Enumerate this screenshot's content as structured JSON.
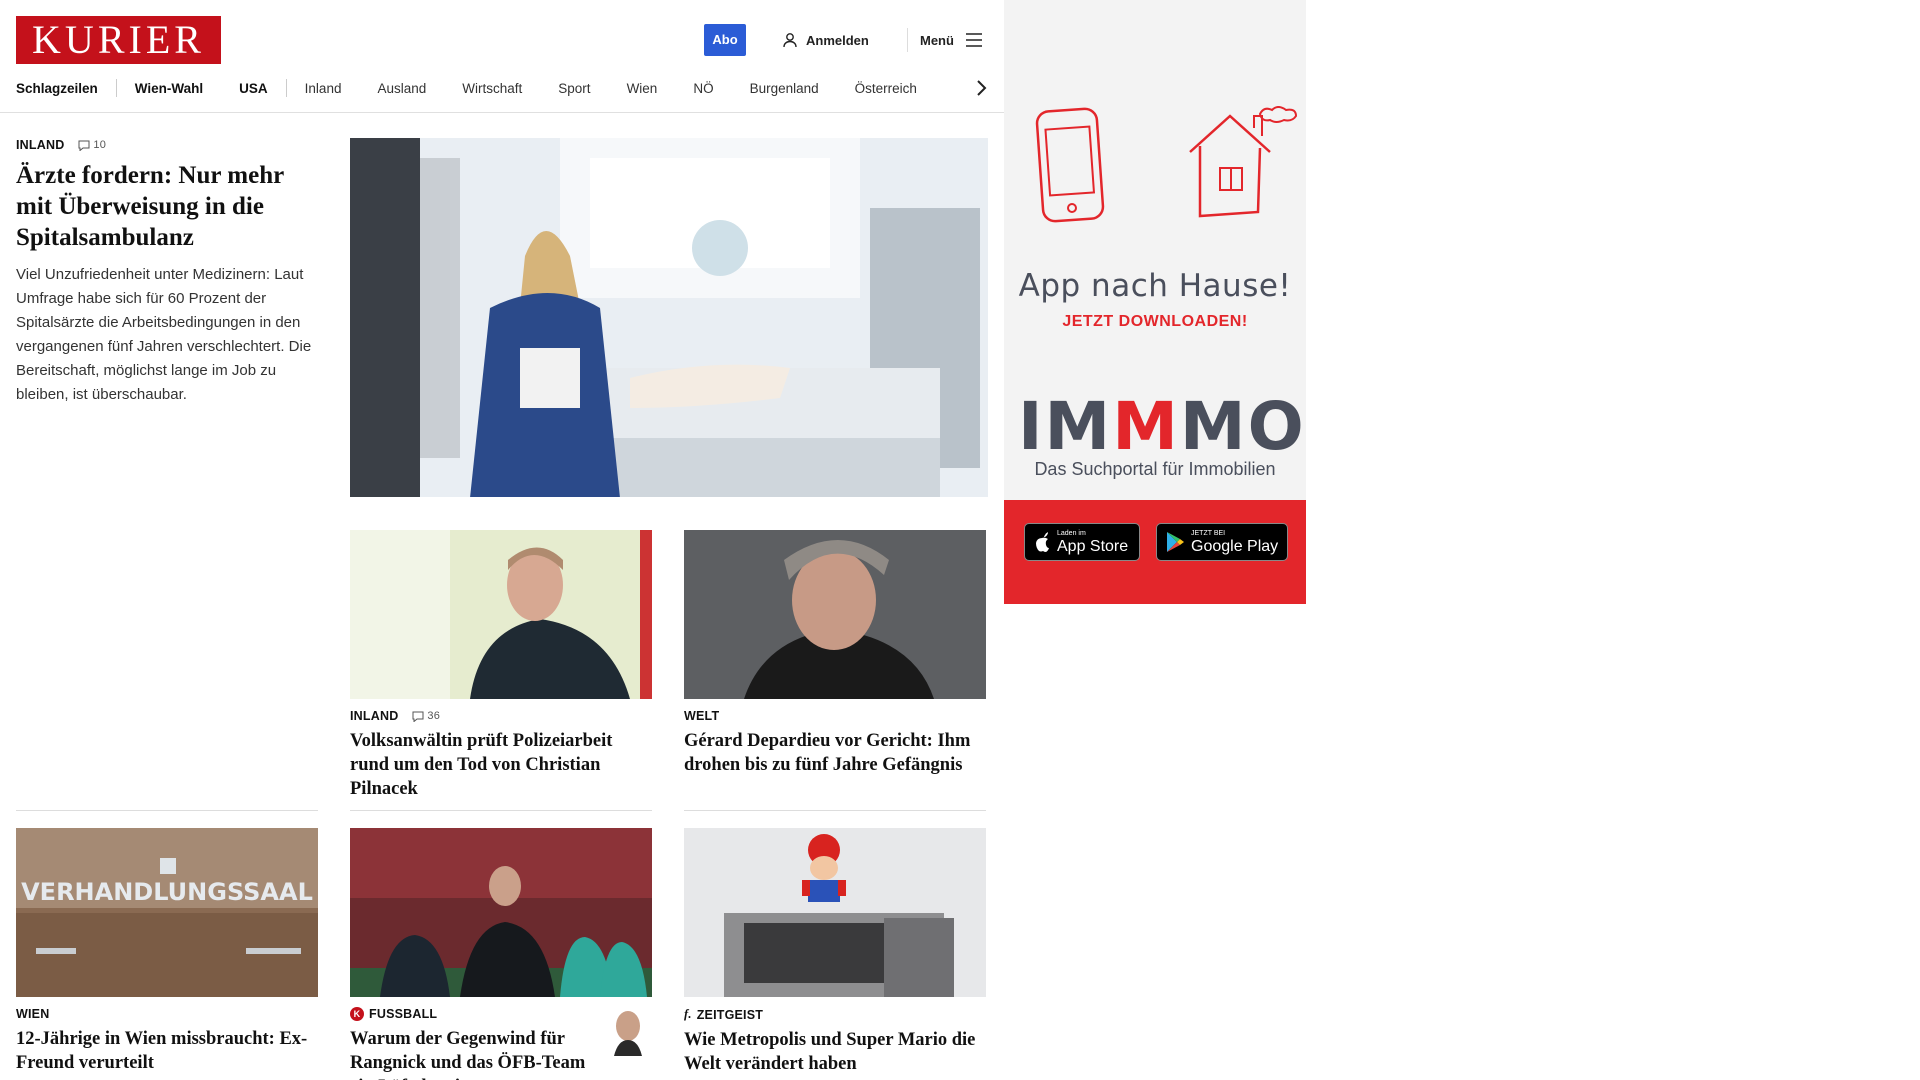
{
  "header": {
    "logo": "KURIER",
    "abo": "Abo",
    "login": "Anmelden",
    "menu": "Menü"
  },
  "nav": [
    "Schlagzeilen",
    "Wien-Wahl",
    "USA",
    "Inland",
    "Ausland",
    "Wirtschaft",
    "Sport",
    "Wien",
    "NÖ",
    "Burgenland",
    "Österreich"
  ],
  "lead": {
    "kicker": "INLAND",
    "comments": "10",
    "headline": "Ärzte fordern: Nur mehr mit Überweisung in die Spitalsambulanz",
    "teaser": "Viel Unzufriedenheit unter Medizinern: Laut Umfrage habe sich für 60 Prozent der Spitalsärzte die Arbeitsbedingungen in den vergangenen fünf Jahren verschlechtert. Die Bereitschaft, möglichst lange im Job zu bleiben, ist überschaubar."
  },
  "cards": [
    {
      "kicker": "INLAND",
      "comments": "36",
      "headline": "Volksanwältin prüft Polizeiarbeit rund um den Tod von Christian Pilnacek"
    },
    {
      "kicker": "WELT",
      "headline": "Gérard Depardieu vor Gericht: Ihm drohen bis zu fünf Jahre Gefängnis"
    },
    {
      "kicker": "WIEN",
      "headline": "12-Jährige in Wien missbraucht: Ex-Freund verurteilt",
      "image_text": "VERHANDLUNGSSAAL"
    },
    {
      "kicker": "FUSSBALL",
      "badge": "K",
      "headline": "Warum der Gegenwind für Rangnick und das ÖFB-Team ein Lüftchen ist"
    },
    {
      "kicker": "ZEITGEIST",
      "badge": "f.",
      "headline": "Wie Metropolis und Super Mario die Welt verändert haben"
    }
  ],
  "ad": {
    "tagline": "App nach Hause!",
    "cta": "JETZT DOWNLOADEN!",
    "brand_a": "IM",
    "brand_m": "M",
    "brand_b": "MO",
    "subline": "Das Suchportal für Immobilien",
    "appstore_small": "Laden im",
    "appstore_big": "App Store",
    "googleplay_small": "JETZT BEI",
    "googleplay_big": "Google Play"
  },
  "colors": {
    "brand_red": "#c4111b",
    "abo_blue": "#2b5cd6",
    "ad_red": "#e3262b"
  }
}
